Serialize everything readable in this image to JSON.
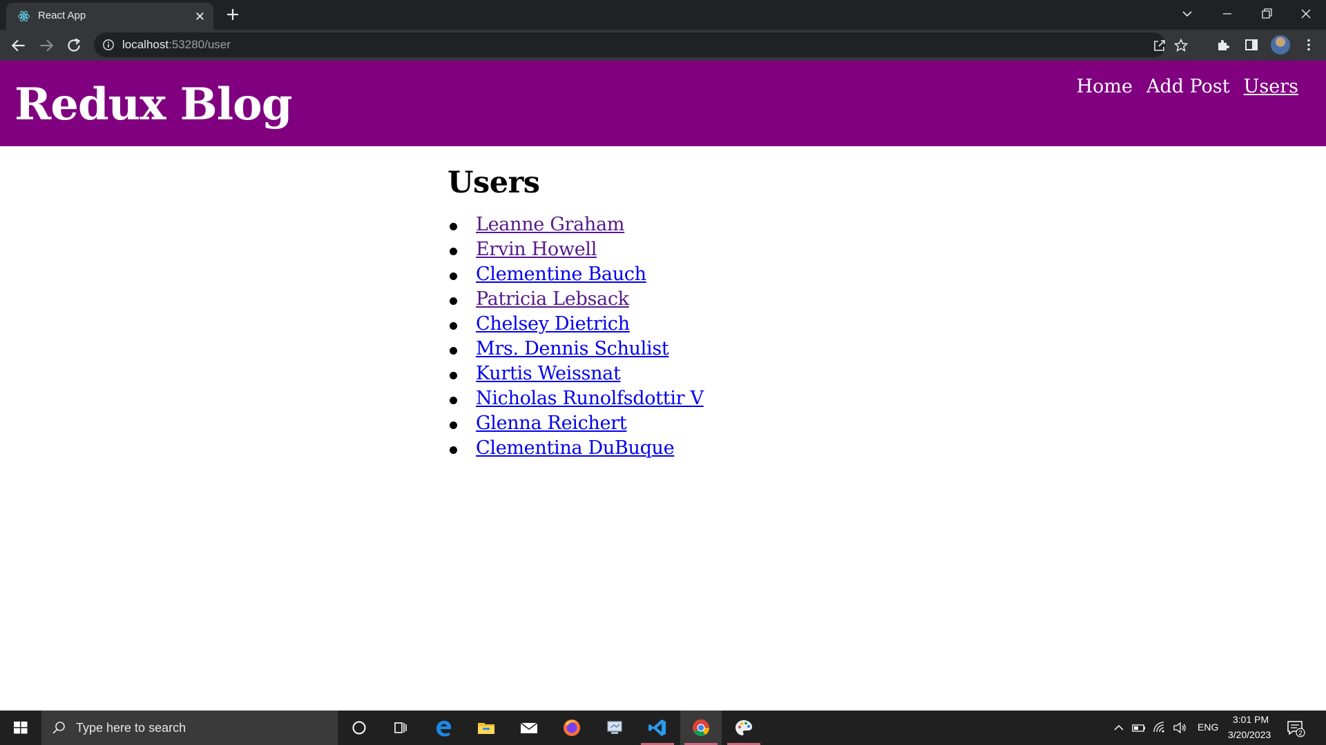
{
  "browser": {
    "tab_title": "React App",
    "url_host": "localhost",
    "url_rest": ":53280/user"
  },
  "site": {
    "title": "Redux Blog",
    "nav": [
      {
        "label": "Home",
        "active": false
      },
      {
        "label": "Add Post",
        "active": false
      },
      {
        "label": "Users",
        "active": true
      }
    ]
  },
  "main": {
    "heading": "Users",
    "users": [
      {
        "name": "Leanne Graham",
        "visited": true
      },
      {
        "name": "Ervin Howell",
        "visited": true
      },
      {
        "name": "Clementine Bauch",
        "visited": false
      },
      {
        "name": "Patricia Lebsack",
        "visited": true
      },
      {
        "name": "Chelsey Dietrich",
        "visited": false
      },
      {
        "name": "Mrs. Dennis Schulist",
        "visited": false
      },
      {
        "name": "Kurtis Weissnat",
        "visited": false
      },
      {
        "name": "Nicholas Runolfsdottir V",
        "visited": false
      },
      {
        "name": "Glenna Reichert",
        "visited": false
      },
      {
        "name": "Clementina DuBuque",
        "visited": false
      }
    ]
  },
  "taskbar": {
    "search_placeholder": "Type here to search",
    "language": "ENG",
    "time": "3:01 PM",
    "date": "3/20/2023",
    "notification_count": "2"
  },
  "colors": {
    "header_bg": "#800080",
    "link": "#0000ee",
    "link_visited": "#551a8b"
  }
}
